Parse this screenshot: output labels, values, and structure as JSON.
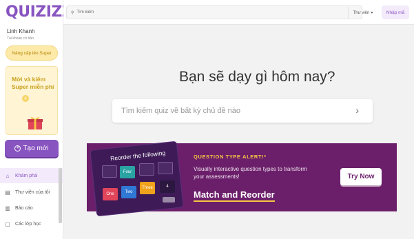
{
  "app": {
    "logo": "QUIZIZZ"
  },
  "sidebar": {
    "user_name": "Linh Khanh",
    "user_sub": "Tài khoản cơ bản",
    "upgrade_label": "Nâng cấp lên Super",
    "promo_text": "Mời và kiếm Super miễn phí",
    "promo_plus": "+",
    "create_label": "Tạo mới",
    "items": [
      {
        "label": "Khám phá",
        "icon": "explore-icon",
        "active": true
      },
      {
        "label": "Thư viện của tôi",
        "icon": "library-icon",
        "active": false
      },
      {
        "label": "Báo cáo",
        "icon": "reports-icon",
        "active": false
      },
      {
        "label": "Các lớp học",
        "icon": "classes-icon",
        "active": false
      }
    ]
  },
  "topbar": {
    "search_placeholder": "Tìm kiếm",
    "library_select": "Thư viện",
    "enter_code": "Nhập mã"
  },
  "main": {
    "heading": "Bạn sẽ dạy gì hôm nay?",
    "search_placeholder": "Tìm kiếm quiz về bất kỳ chủ đề nào"
  },
  "banner": {
    "card_title": "Reorder the following",
    "tiles": [
      "Four",
      "One",
      "Two",
      "Three",
      "4"
    ],
    "alert_title": "QUESTION TYPE ALERT!*",
    "alert_desc": "Visually interactive question types to transform your assessments!",
    "alert_cta": "Match and Reorder",
    "try_label": "Try Now"
  },
  "colors": {
    "brand": "#8854c0",
    "banner_bg": "#6b1f6a",
    "accent_yellow": "#f7c744",
    "tile_teal": "#2aa3a3",
    "tile_red": "#e0455a",
    "tile_blue": "#2f78d6",
    "tile_orange": "#f0a21c"
  }
}
